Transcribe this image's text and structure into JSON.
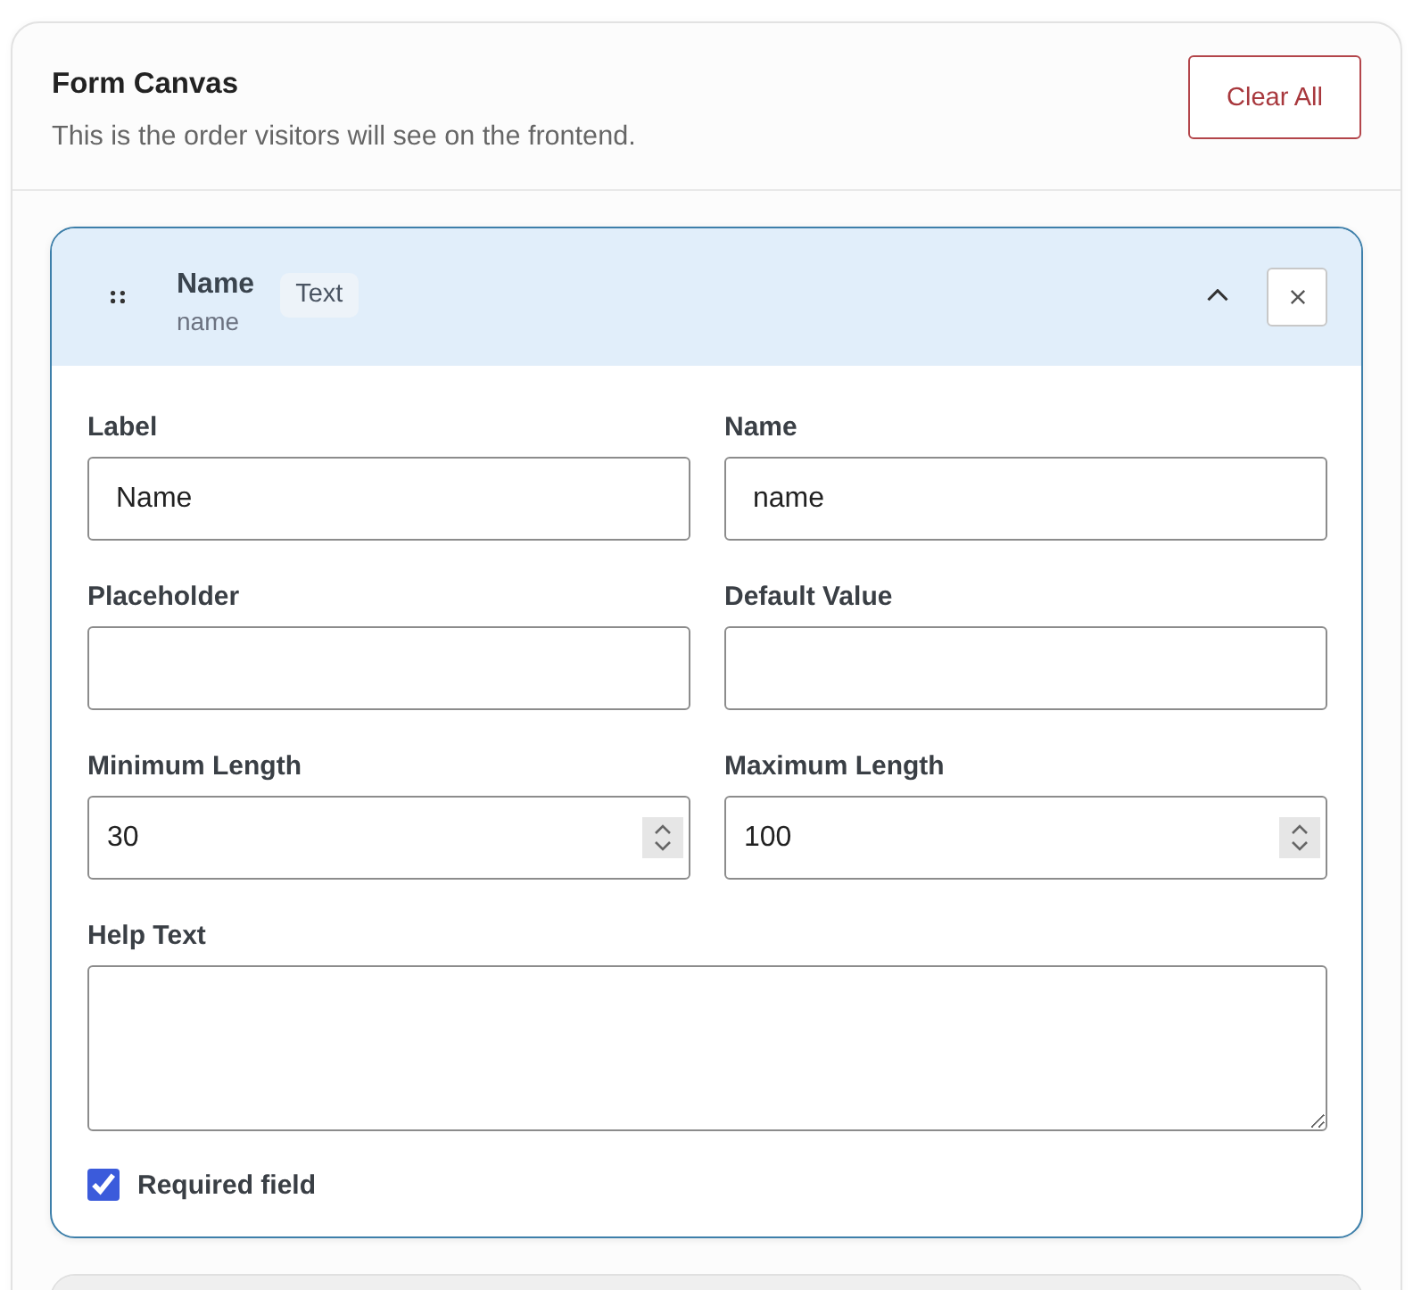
{
  "panel": {
    "title": "Form Canvas",
    "subtitle": "This is the order visitors will see on the frontend.",
    "clear_button": "Clear All"
  },
  "fields": [
    {
      "title": "Name",
      "subtitle": "name",
      "type_badge": "Text",
      "expanded": true,
      "settings": [
        {
          "kind": "text",
          "label": "Label",
          "value": "Name"
        },
        {
          "kind": "text",
          "label": "Name",
          "value": "name"
        },
        {
          "kind": "text",
          "label": "Placeholder"
        },
        {
          "kind": "text",
          "label": "Default Value"
        },
        {
          "kind": "number",
          "label": "Minimum Length",
          "value": "30"
        },
        {
          "kind": "number",
          "label": "Maximum Length",
          "value": "100"
        },
        {
          "kind": "textarea",
          "label": "Help Text"
        }
      ],
      "required": {
        "label": "Required field",
        "checked": true
      }
    },
    {
      "expanded": false
    }
  ]
}
